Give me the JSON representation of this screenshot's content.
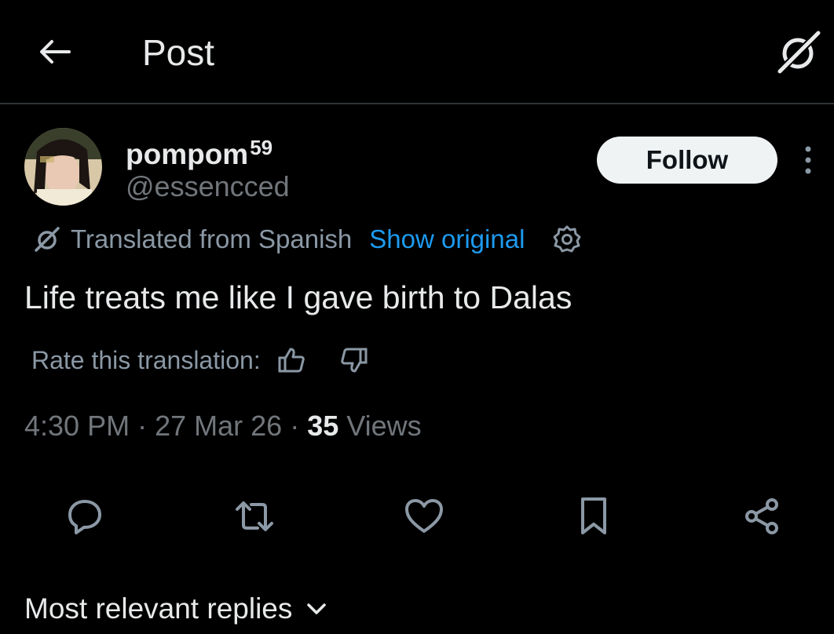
{
  "header": {
    "title": "Post",
    "back_icon": "arrow-left-icon",
    "grok_icon": "grok-icon"
  },
  "author": {
    "display_name": "pompom",
    "display_name_sup": "59",
    "handle": "@essencced",
    "avatar": "avatar-photo"
  },
  "follow_label": "Follow",
  "more_icon": "more-vertical-icon",
  "translation": {
    "note": "Translated from Spanish",
    "show_original": "Show original",
    "settings_icon": "gear-icon"
  },
  "tweet_text": "Life treats me like I gave birth to Dalas",
  "rate": {
    "label": "Rate this translation:",
    "up_icon": "thumbs-up-icon",
    "down_icon": "thumbs-down-icon"
  },
  "meta": {
    "time": "4:30 PM",
    "date": "27 Mar 26",
    "views_count": "35",
    "views_label": "Views",
    "sep": "·"
  },
  "actions": [
    {
      "name": "reply",
      "icon": "reply-icon"
    },
    {
      "name": "repost",
      "icon": "repost-icon"
    },
    {
      "name": "like",
      "icon": "heart-icon"
    },
    {
      "name": "bookmark",
      "icon": "bookmark-icon"
    },
    {
      "name": "share",
      "icon": "share-icon"
    }
  ],
  "replies_sort": {
    "label": "Most relevant replies",
    "icon": "chevron-down-icon"
  },
  "colors": {
    "background": "#000000",
    "text": "#e7e9ea",
    "muted": "#71767b",
    "link": "#1d9bf0",
    "follow_bg": "#eff3f4"
  }
}
